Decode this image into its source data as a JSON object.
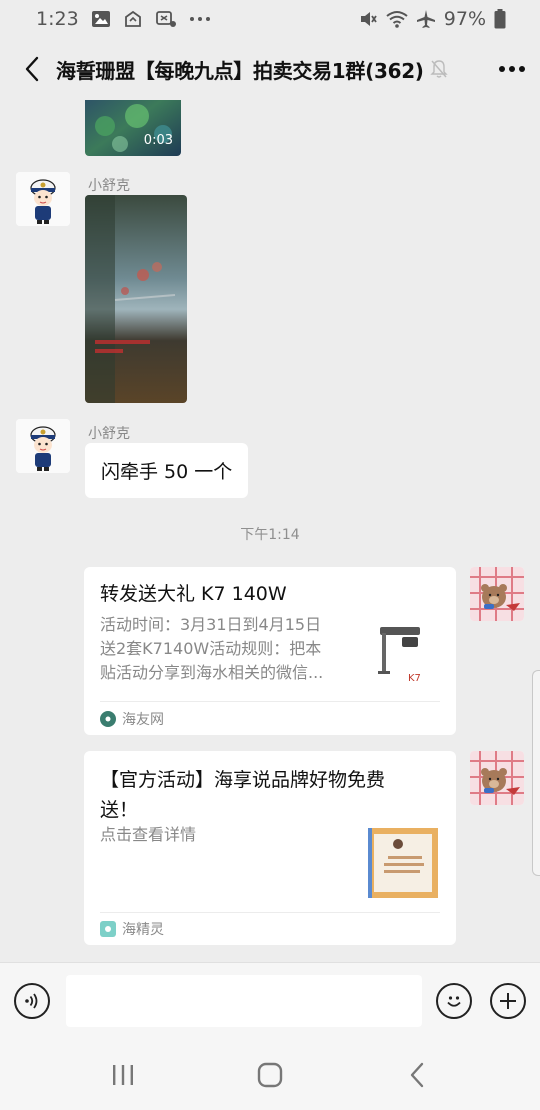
{
  "status": {
    "time": "1:23",
    "battery": "97%",
    "left_icons": [
      "gallery-icon",
      "parcel-icon",
      "notification-icon",
      "more-dots-icon"
    ],
    "right_icons": [
      "mute-icon",
      "wifi-icon",
      "airplane-icon",
      "battery-icon"
    ]
  },
  "header": {
    "title": "海誓珊盟【每晚九点】拍卖交易1群(362)"
  },
  "messages": {
    "video_duration": "0:03",
    "sender1_name": "小舒克",
    "sender2_name": "小舒克",
    "text_msg": "闪牵手 50 一个",
    "timestamp": "下午1:14",
    "card1": {
      "title": "转发送大礼 K7 140W",
      "desc_lines": [
        "活动时间：3月31日到4月15日",
        "送2套K7140W活动规则：把本",
        "贴活动分享到海水相关的微信..."
      ],
      "source": "海友网"
    },
    "card2": {
      "title_lines": [
        "【官方活动】海享说品牌好物免费",
        "送！"
      ],
      "desc": "点击查看详情",
      "source": "海精灵"
    }
  },
  "input": {
    "placeholder": ""
  },
  "colors": {
    "background": "#ededed",
    "bubble": "#ffffff",
    "text": "#111111",
    "muted": "#888888"
  }
}
